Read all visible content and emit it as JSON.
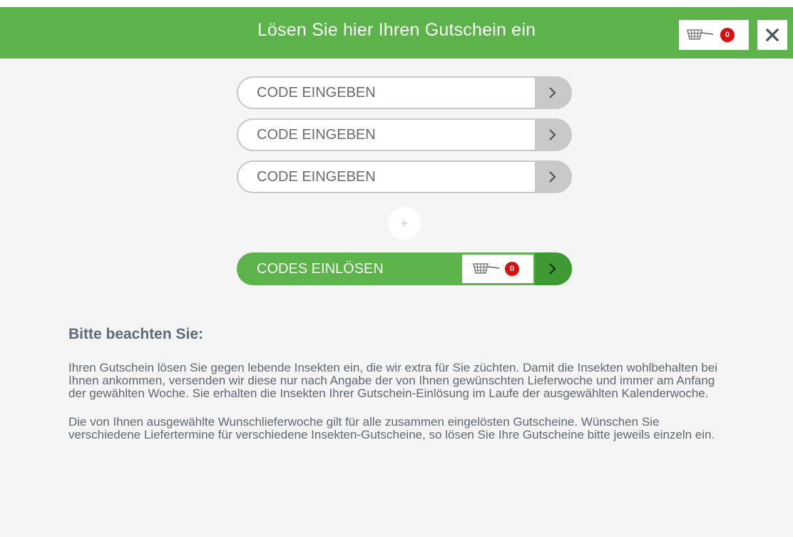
{
  "header": {
    "title": "Lösen Sie hier Ihren Gutschein ein",
    "cart_count": "0",
    "close_icon": "close-icon",
    "cart_icon": "insect-net-icon"
  },
  "codes": {
    "placeholder": "CODE EINGEBEN",
    "submit_icon": "chevron-right-icon"
  },
  "add_button": {
    "label": "+"
  },
  "redeem": {
    "label": "CODES EINLÖSEN",
    "cart_count": "0"
  },
  "notes": {
    "heading": "Bitte beachten Sie:",
    "paragraph1": "Ihren Gutschein lösen Sie gegen lebende Insekten ein, die wir extra für Sie züchten. Damit die Insekten wohlbehalten bei Ihnen ankommen, versenden wir diese nur nach Angabe der von Ihnen gewünschten Lieferwoche und immer am Anfang der gewählten Woche. Sie erhalten die Insekten Ihrer Gutschein-Einlösung im Laufe der ausgewählten Kalenderwoche.",
    "paragraph2": "Die von Ihnen ausgewählte Wunschlieferwoche gilt für alle zusammen eingelösten Gutscheine. Wünschen Sie verschiedene Liefertermine für verschiedene Insekten-Gutscheine, so lösen Sie Ihre Gutscheine bitte jeweils einzeln ein."
  },
  "colors": {
    "brand_green": "#5cb34a",
    "dark_green": "#3f9a34",
    "badge_red": "#d90f0f",
    "text_gray": "#5e6873"
  }
}
